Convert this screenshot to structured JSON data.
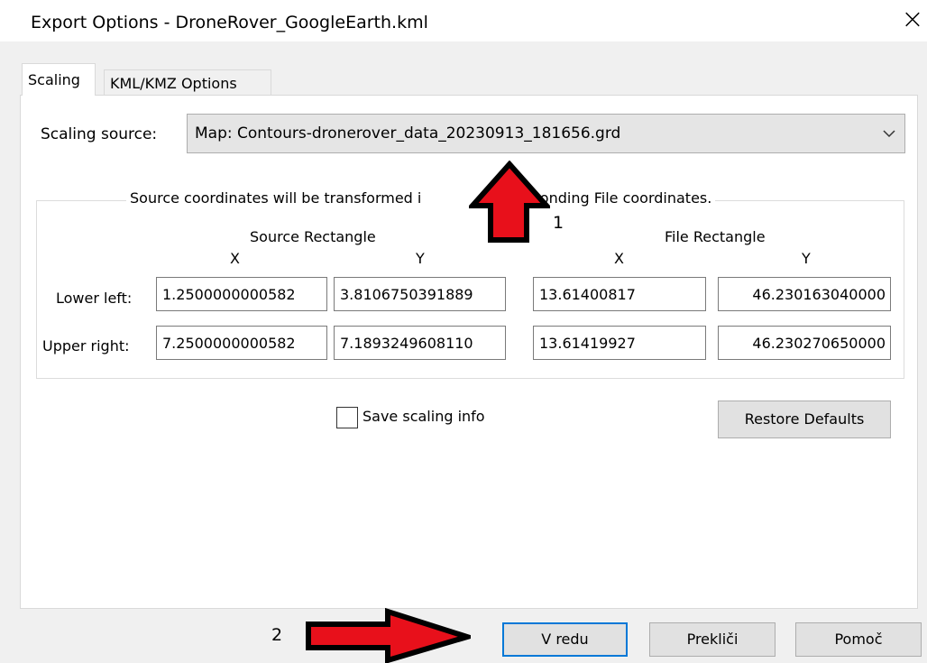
{
  "window": {
    "title": "Export Options - DroneRover_GoogleEarth.kml",
    "close_glyph": "×"
  },
  "tabs": [
    {
      "label": "Scaling",
      "active": true
    },
    {
      "label": "KML/KMZ Options",
      "active": false
    }
  ],
  "scaling": {
    "source_label": "Scaling source:",
    "source_value": "Map: Contours-dronerover_data_20230913_181656.grd",
    "group_caption_left": "Source coordinates will be transformed i",
    "group_caption_right": "corresponding File coordinates.",
    "source_rect_header": "Source Rectangle",
    "file_rect_header": "File Rectangle",
    "x_header": "X",
    "y_header": "Y",
    "rows": [
      {
        "label": "Lower left:",
        "src_x": "1.2500000000582",
        "src_y": "3.8106750391889",
        "file_x": "13.61400817",
        "file_y": "46.230163040000"
      },
      {
        "label": "Upper right:",
        "src_x": "7.2500000000582",
        "src_y": "7.1893249608110",
        "file_x": "13.61419927",
        "file_y": "46.230270650000"
      }
    ],
    "save_scaling_label": "Save scaling info",
    "save_scaling_checked": false,
    "restore_defaults_label": "Restore Defaults"
  },
  "buttons": {
    "ok": "V redu",
    "cancel": "Prekliči",
    "help": "Pomoč"
  },
  "annotations": {
    "marker_1": "1",
    "marker_2": "2",
    "arrow_color": "#e8101b"
  }
}
